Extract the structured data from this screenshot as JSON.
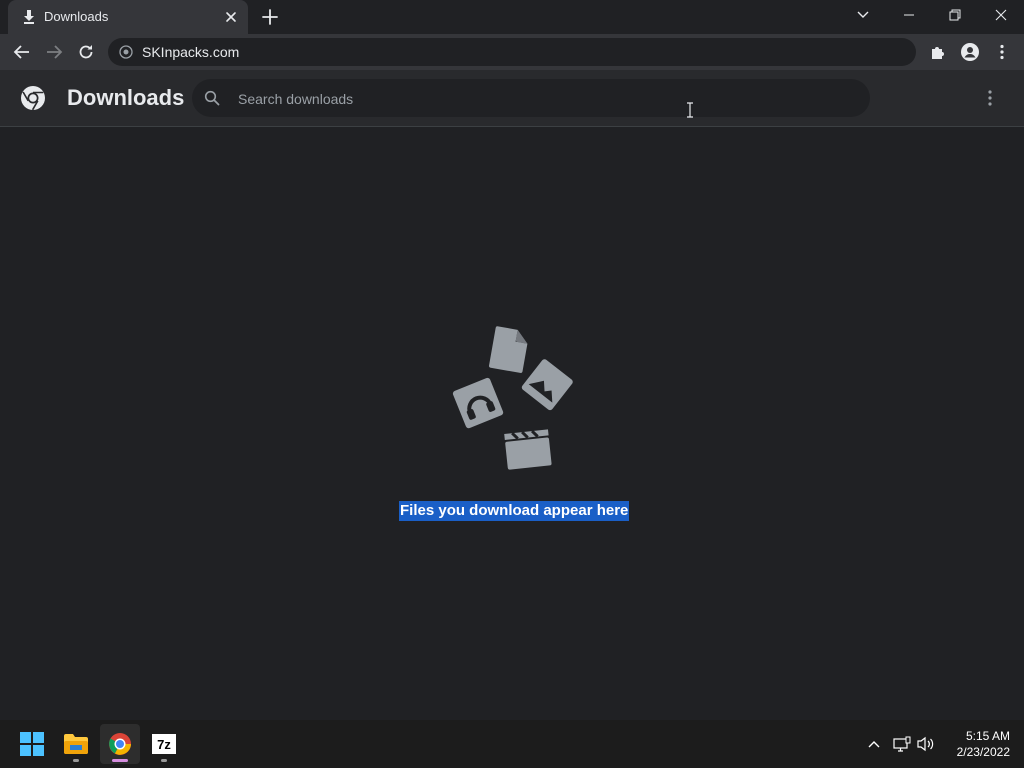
{
  "tab": {
    "title": "Downloads",
    "icon": "download-icon"
  },
  "toolbar": {
    "url": "SKInpacks.com"
  },
  "downloads": {
    "title": "Downloads",
    "search_placeholder": "Search downloads",
    "empty_message": "Files you download appear here"
  },
  "taskbar": {
    "apps": [
      "start",
      "file-explorer",
      "chrome",
      "7-zip"
    ],
    "sevenzip_label": "7z"
  },
  "clock": {
    "time": "5:15 AM",
    "date": "2/23/2022"
  },
  "colors": {
    "background": "#202124",
    "toolbar": "#35363a",
    "selection": "#1a5fc7",
    "text": "#e8eaed"
  }
}
